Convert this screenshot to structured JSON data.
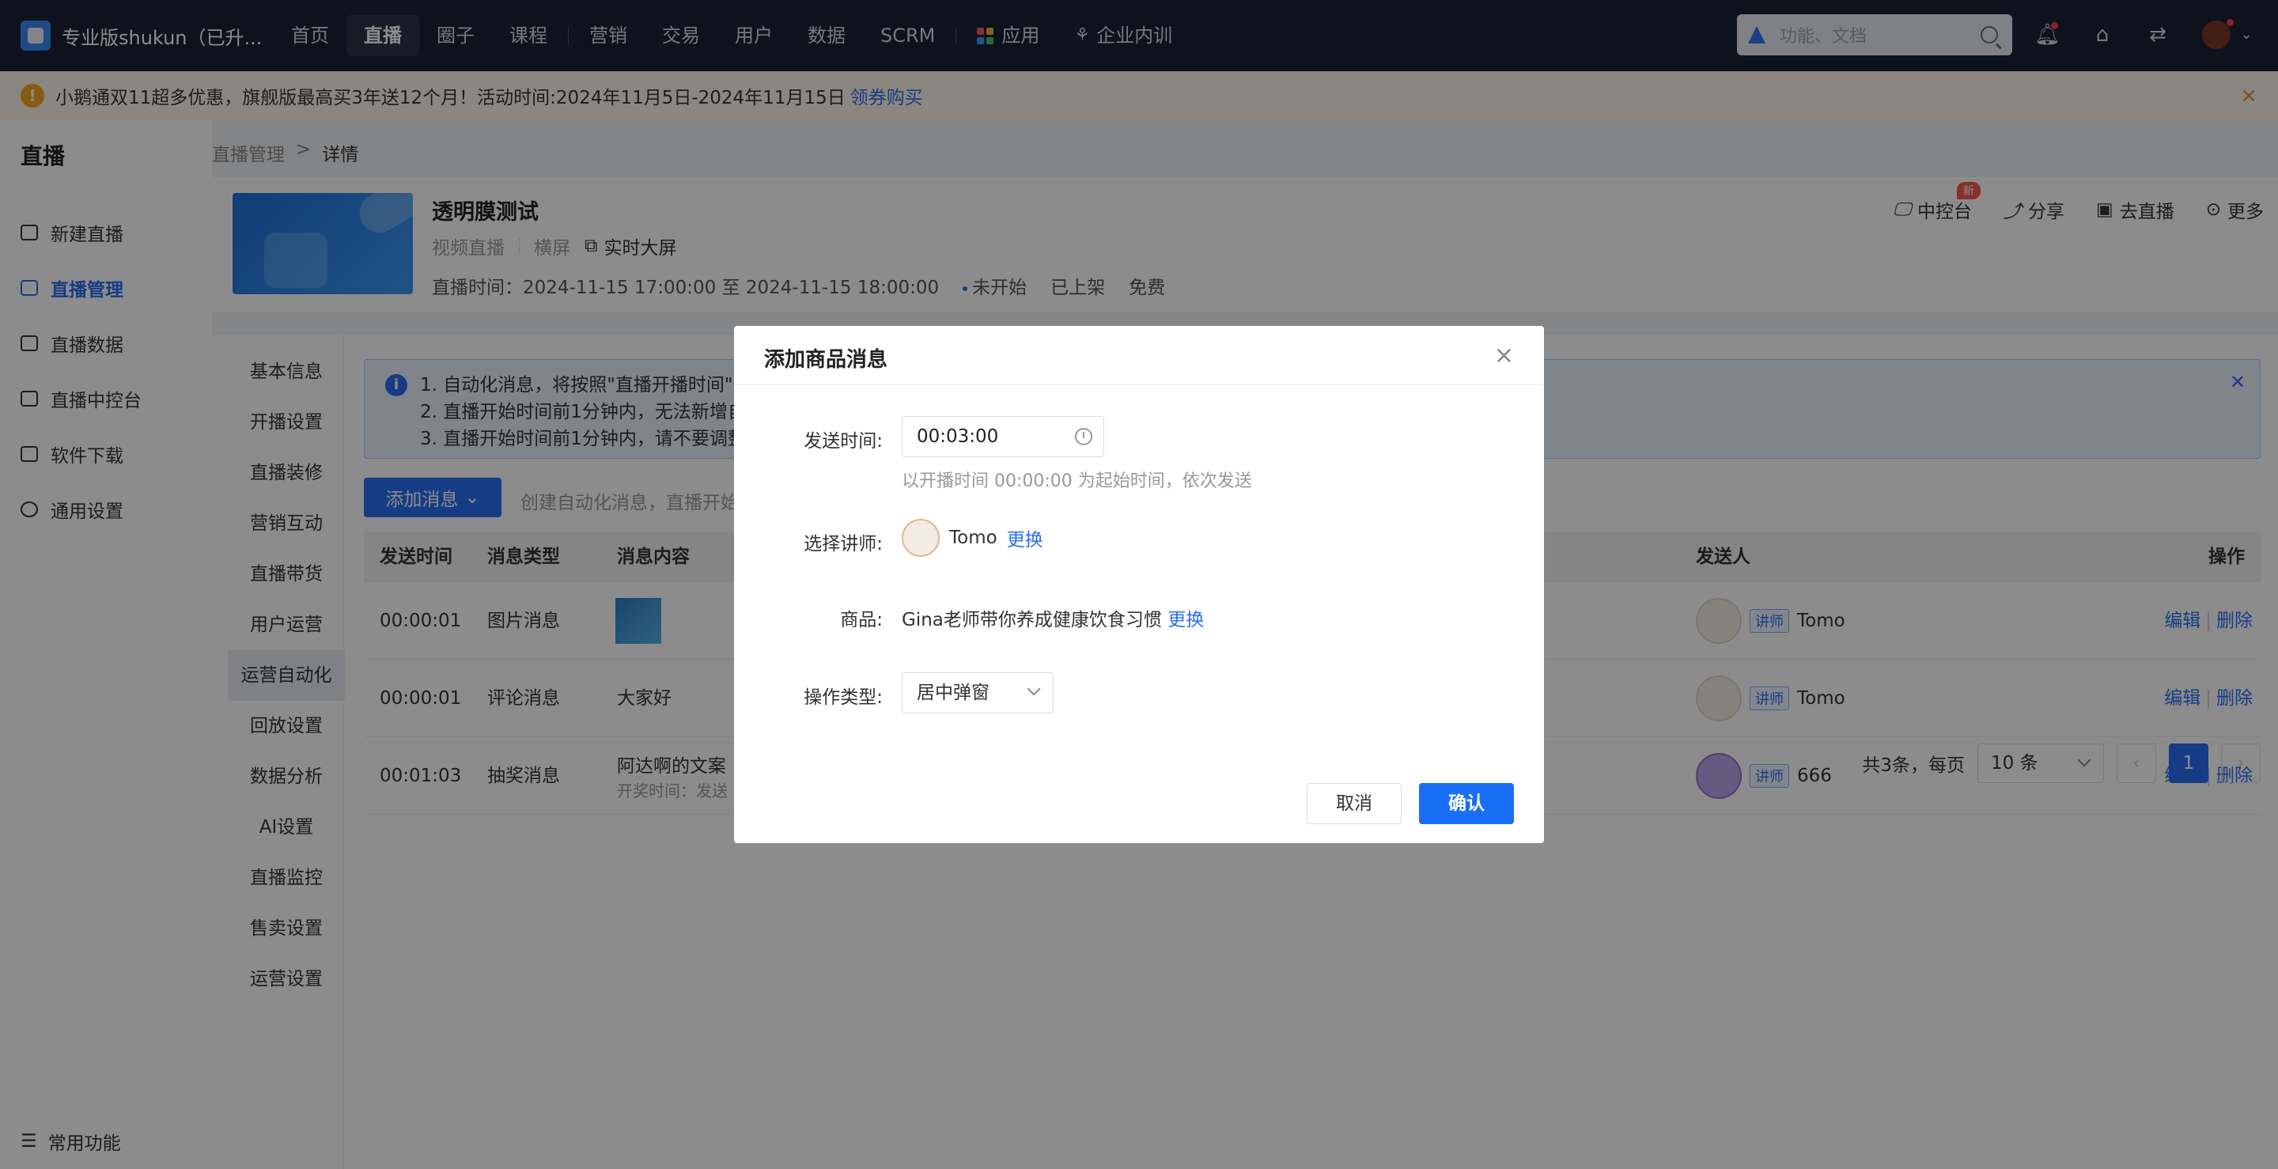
{
  "topbar": {
    "brand": "专业版shukun（已升...",
    "nav": [
      "首页",
      "直播",
      "圈子",
      "课程",
      "营销",
      "交易",
      "用户",
      "数据",
      "SCRM",
      "应用",
      "企业内训"
    ],
    "active": "直播",
    "search_placeholder": "功能、文档"
  },
  "banner": {
    "text": "小鹅通双11超多优惠，旗舰版最高买3年送12个月！活动时间:2024年11月5日-2024年11月15日",
    "link": "领券购买",
    "close": "×"
  },
  "sidebar": {
    "title": "直播",
    "items": [
      "新建直播",
      "直播管理",
      "直播数据",
      "直播中控台",
      "软件下载",
      "通用设置"
    ],
    "active": "直播管理",
    "bottom": "常用功能"
  },
  "breadcrumb": [
    "直播管理",
    ">",
    "详情"
  ],
  "live": {
    "title": "透明膜测试",
    "type": "视频直播",
    "orientation": "横屏",
    "bigscreen": "实时大屏",
    "time": "直播时间：2024-11-15 17:00:00 至 2024-11-15 18:00:00",
    "status": "未开始",
    "shelf": "已上架",
    "price": "免费",
    "actions": [
      "中控台",
      "分享",
      "去直播",
      "更多"
    ],
    "new_badge": "新"
  },
  "subnav": [
    "基本信息",
    "开播设置",
    "直播装修",
    "营销互动",
    "直播带货",
    "用户运营",
    "运营自动化",
    "回放设置",
    "数据分析",
    "AI设置",
    "直播监控",
    "售卖设置",
    "运营设置"
  ],
  "subnav_active": "运营自动化",
  "tips": [
    "1. 自动化消息，将按照\"直播开播时间\"自",
    "2. 直播开始时间前1分钟内，无法新增自",
    "3. 直播开始时间前1分钟内，请不要调整"
  ],
  "toolbar": {
    "add_label": "添加消息",
    "hint": "创建自动化消息，直播开始"
  },
  "table": {
    "headers": [
      "发送时间",
      "消息类型",
      "消息内容",
      "发送人",
      "操作"
    ],
    "rows": [
      {
        "time": "00:00:01",
        "type": "图片消息",
        "content": "",
        "sub": "",
        "role": "讲师",
        "sender": "Tomo"
      },
      {
        "time": "00:00:01",
        "type": "评论消息",
        "content": "大家好",
        "sub": "",
        "role": "讲师",
        "sender": "Tomo"
      },
      {
        "time": "00:01:03",
        "type": "抽奖消息",
        "content": "阿达啊的文案",
        "sub": "开奖时间：发送",
        "role": "讲师",
        "sender": "666"
      }
    ],
    "edit": "编辑",
    "delete": "删除"
  },
  "pager": {
    "total": "共3条，每页",
    "size": "10 条",
    "current": "1",
    "prev": "‹",
    "next": "›"
  },
  "modal": {
    "title": "添加商品消息",
    "send_time_label": "发送时间:",
    "send_time": "00:03:00",
    "hint": "以开播时间 00:00:00 为起始时间，依次发送",
    "teacher_label": "选择讲师:",
    "teacher": "Tomo",
    "change": "更换",
    "goods_label": "商品:",
    "goods": "Gina老师带你养成健康饮食习惯",
    "op_label": "操作类型:",
    "op_value": "居中弹窗",
    "cancel": "取消",
    "ok": "确认"
  },
  "colors": {
    "primary": "#2a6ef5",
    "topbar": "#1a2233",
    "banner": "#fdf6e9",
    "warn": "#f5a623"
  }
}
